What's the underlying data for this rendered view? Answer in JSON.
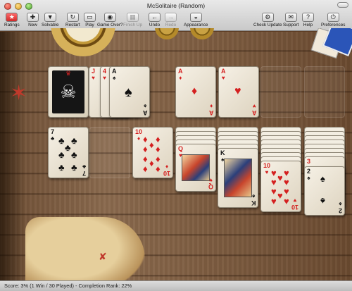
{
  "window": {
    "title": "McSolitaire (Random)"
  },
  "toolbar": {
    "items": [
      {
        "label": "Ratings",
        "icon": "star-icon"
      },
      {
        "label": "New",
        "icon": "plus-icon"
      },
      {
        "label": "Solvable",
        "icon": "funnel-icon"
      },
      {
        "label": "Restart",
        "icon": "restart-icon"
      },
      {
        "label": "Play",
        "icon": "play-icon"
      },
      {
        "label": "Game Over?",
        "icon": "eye-icon"
      },
      {
        "label": "Finish Up",
        "icon": "cards-icon"
      },
      {
        "label": "Undo",
        "icon": "arrow-left-icon"
      },
      {
        "label": "Redo",
        "icon": "arrow-right-icon"
      },
      {
        "label": "Appearance",
        "icon": "mask-icon"
      },
      {
        "label": "Check Update",
        "icon": "gear-icon"
      },
      {
        "label": "Support",
        "icon": "envelope-icon"
      },
      {
        "label": "Help",
        "icon": "question-icon"
      },
      {
        "label": "Preferences",
        "icon": "switch-icon"
      }
    ]
  },
  "cards": {
    "stock": {
      "glyph": "☠",
      "crown": "♛"
    },
    "waste": [
      {
        "rank": "J",
        "suit": "♥"
      },
      {
        "rank": "4",
        "suit": "♥"
      },
      {
        "rank": "A",
        "suit": "♠"
      }
    ],
    "foundations": [
      {
        "rank": "A",
        "suit": "♦"
      },
      {
        "rank": "A",
        "suit": "♥"
      }
    ],
    "tableau": [
      {
        "rank": "7",
        "suit": "♣"
      },
      {
        "rank": "10",
        "suit": "♦"
      },
      {
        "rank": "Q",
        "suit": "♥"
      },
      {
        "rank": "K",
        "suit": "♠"
      },
      {
        "rank": "10",
        "suit": "♥"
      },
      {
        "rank": "3",
        "suit": "♥"
      },
      {
        "rank": "2",
        "suit": "♠"
      }
    ]
  },
  "status": {
    "text": "Score: 3% (1 Win / 30 Played) - Completion Rank: 22%"
  },
  "colors": {
    "red_suit": "#d42020",
    "black_suit": "#111111",
    "star_button": "#d12a2a"
  }
}
